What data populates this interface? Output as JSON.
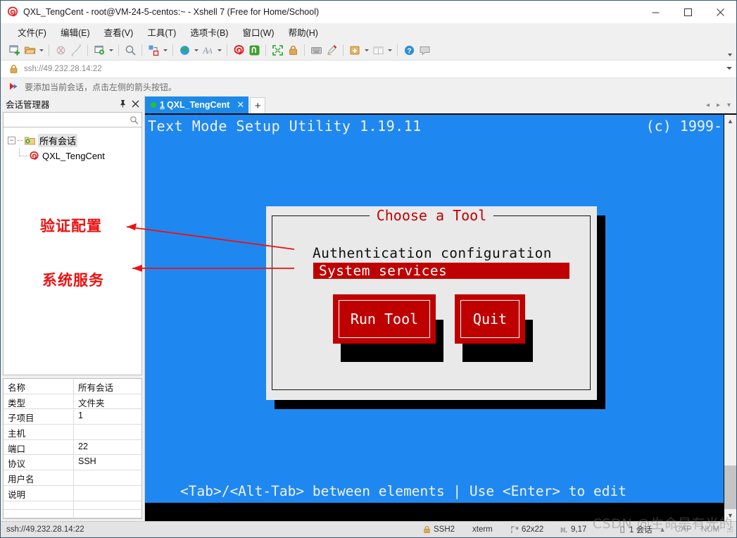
{
  "window": {
    "title": "QXL_TengCent - root@VM-24-5-centos:~ - Xshell 7 (Free for Home/School)",
    "app_icon": "xshell-spiral-icon",
    "minimize": "—",
    "maximize": "□",
    "close": "✕"
  },
  "menu": {
    "items": [
      {
        "label": "文件(F)",
        "name": "menu-file"
      },
      {
        "label": "编辑(E)",
        "name": "menu-edit"
      },
      {
        "label": "查看(V)",
        "name": "menu-view"
      },
      {
        "label": "工具(T)",
        "name": "menu-tools"
      },
      {
        "label": "选项卡(B)",
        "name": "menu-tabs"
      },
      {
        "label": "窗口(W)",
        "name": "menu-window"
      },
      {
        "label": "帮助(H)",
        "name": "menu-help"
      }
    ]
  },
  "address_bar": {
    "value": "ssh://49.232.28.14:22",
    "lock_icon": "lock-icon"
  },
  "hint_bar": {
    "text": "要添加当前会话，点击左侧的箭头按钮。",
    "icon": "red-arrow-flag-icon"
  },
  "session_manager": {
    "title": "会话管理器",
    "pin_label": "⚐",
    "close_label": "✕",
    "search_placeholder": "",
    "search_value": "",
    "root": {
      "label": "所有会话",
      "expander": "−"
    },
    "child": {
      "label": "QXL_TengCent"
    }
  },
  "properties": {
    "rows": [
      {
        "key": "名称",
        "value": "所有会话"
      },
      {
        "key": "类型",
        "value": "文件夹"
      },
      {
        "key": "子项目",
        "value": "1"
      },
      {
        "key": "主机",
        "value": ""
      },
      {
        "key": "端口",
        "value": "22"
      },
      {
        "key": "协议",
        "value": "SSH"
      },
      {
        "key": "用户名",
        "value": ""
      },
      {
        "key": "说明",
        "value": ""
      },
      {
        "key": "",
        "value": ""
      },
      {
        "key": "",
        "value": ""
      }
    ]
  },
  "tabs": {
    "active": {
      "number": "1",
      "label": "QXL_TengCent",
      "close": "✕",
      "status": "connected"
    },
    "new_tab": "+",
    "scroll_left": "◂",
    "scroll_right": "▸",
    "menu": "▾"
  },
  "terminal": {
    "header_left": "Text Mode Setup Utility 1.19.11",
    "header_right": "(c) 1999-",
    "footer": "<Tab>/<Alt-Tab> between elements  |   Use <Enter> to edit",
    "dialog": {
      "title": "Choose a Tool",
      "options": [
        {
          "label": "Authentication configuration",
          "selected": false
        },
        {
          "label": "System services",
          "selected": true
        }
      ],
      "buttons": [
        {
          "label": "Run Tool",
          "name": "run-tool-button"
        },
        {
          "label": "Quit",
          "name": "quit-button"
        }
      ]
    },
    "colors": {
      "background_blue": "#1f88f0",
      "dialog_bg": "#e9e9e9",
      "red": "#bf0000",
      "title_red": "#c00000"
    }
  },
  "annotations": [
    {
      "text": "验证配置",
      "name": "annotation-auth-config"
    },
    {
      "text": "系统服务",
      "name": "annotation-system-services"
    }
  ],
  "status_bar": {
    "url": "ssh://49.232.28.14:22",
    "protocol": "SSH2",
    "term_type": "xterm",
    "size": "62x22",
    "cursor": "9,17",
    "sessions": "1 会话",
    "caps": "CAP",
    "num": "NUM"
  },
  "watermark": "CSDN @生命是有光的",
  "toolbar": {
    "groups": [
      [
        {
          "name": "new-session-icon"
        },
        {
          "name": "open-folder-icon",
          "caret": true
        }
      ],
      [
        {
          "name": "disconnect-icon"
        },
        {
          "name": "reconnect-icon"
        }
      ],
      [
        {
          "name": "session-properties-icon",
          "caret": true
        }
      ],
      [
        {
          "name": "find-icon"
        }
      ],
      [
        {
          "name": "transfer-icon",
          "caret": true
        }
      ],
      [
        {
          "name": "globe-icon",
          "caret": true
        },
        {
          "name": "font-icon",
          "caret": true
        }
      ],
      [
        {
          "name": "xshell-icon"
        },
        {
          "name": "xftp-icon"
        }
      ],
      [
        {
          "name": "fullscreen-icon"
        },
        {
          "name": "lock-icon"
        }
      ],
      [
        {
          "name": "keyboard-icon"
        },
        {
          "name": "highlight-icon"
        }
      ],
      [
        {
          "name": "add-panel-icon",
          "caret": true
        },
        {
          "name": "layout-icon",
          "caret": true
        }
      ],
      [
        {
          "name": "help-icon"
        },
        {
          "name": "feedback-icon"
        }
      ]
    ]
  }
}
